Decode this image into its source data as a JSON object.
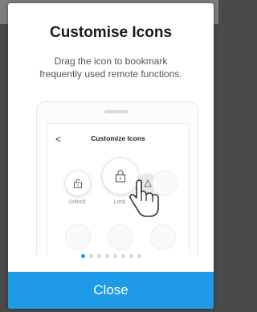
{
  "dialog": {
    "title": "Customise Icons",
    "subtitle_line1": "Drag the icon to bookmark",
    "subtitle_line2": "frequently used remote functions.",
    "close_label": "Close",
    "page_count": 8,
    "active_page": 1
  },
  "illustration": {
    "screen_title": "Customize Icons",
    "back_glyph": "<",
    "icons": [
      {
        "label": "Unlock",
        "icon": "unlock-icon"
      },
      {
        "label": "Lock",
        "icon": "lock-icon"
      }
    ]
  },
  "colors": {
    "accent": "#1e9ae8",
    "backdrop": "#4a4a4a"
  }
}
